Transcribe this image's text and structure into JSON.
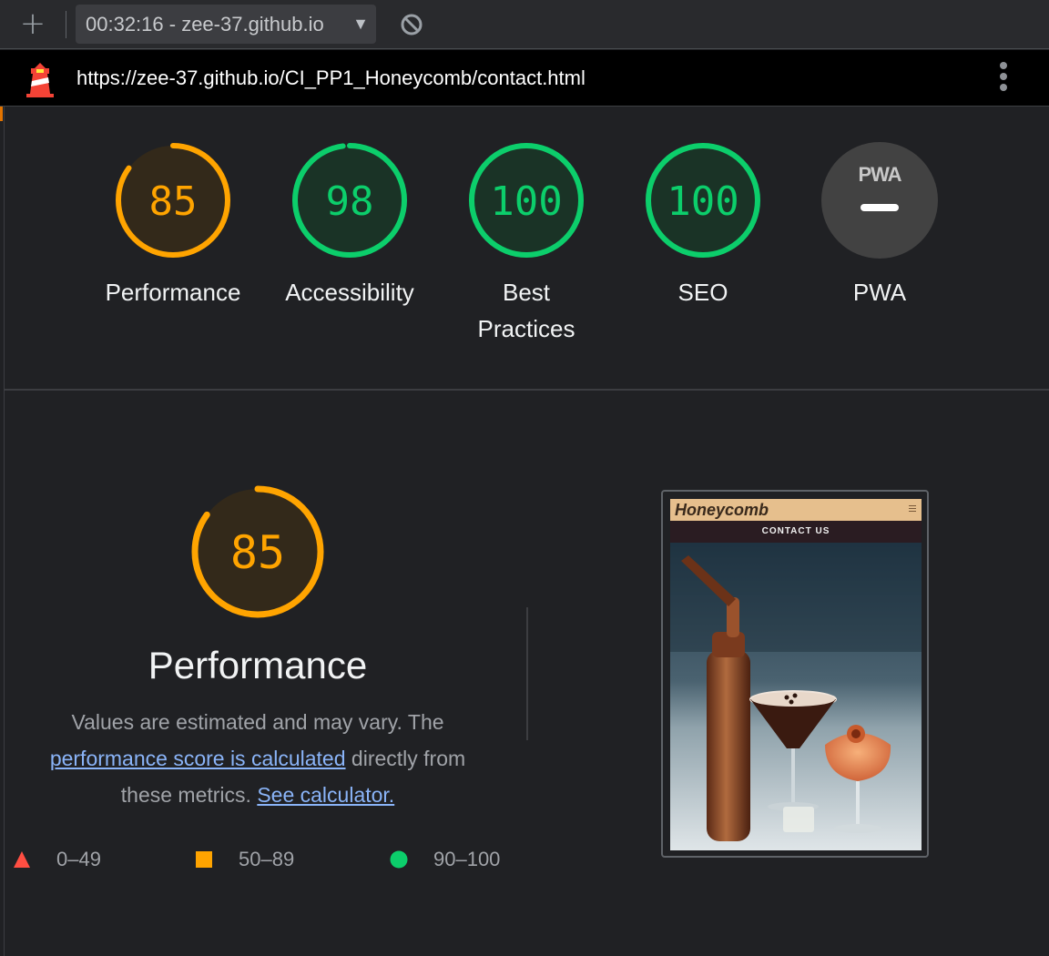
{
  "toolbar": {
    "new_report_icon": "plus-icon",
    "report_selector": "00:32:16 - zee-37.github.io",
    "clear_icon": "block-icon"
  },
  "urlbar": {
    "url": "https://zee-37.github.io/CI_PP1_Honeycomb/contact.html"
  },
  "colors": {
    "average": "#ffa400",
    "pass": "#0cce6b",
    "fail": "#ff4e42",
    "link": "#8ab4f8"
  },
  "gauges": [
    {
      "name": "performance",
      "score": "85",
      "value": 85,
      "label": "Performance",
      "rating": "average"
    },
    {
      "name": "accessibility",
      "score": "98",
      "value": 98,
      "label": "Accessibility",
      "rating": "pass"
    },
    {
      "name": "best-practices",
      "score": "100",
      "value": 100,
      "label": "Best Practices",
      "rating": "pass"
    },
    {
      "name": "seo",
      "score": "100",
      "value": 100,
      "label": "SEO",
      "rating": "pass"
    },
    {
      "name": "pwa",
      "score": "",
      "value": 0,
      "label": "PWA",
      "rating": "na",
      "badge": "PWA"
    }
  ],
  "performance_section": {
    "score": "85",
    "value": 85,
    "title": "Performance",
    "desc_start": "Values are estimated and may vary. The ",
    "link_score": "performance score is calculated",
    "desc_mid": " directly from these metrics. ",
    "link_calc": "See calculator.",
    "legend": [
      {
        "shape": "triangle",
        "range": "0–49"
      },
      {
        "shape": "square",
        "range": "50–89"
      },
      {
        "shape": "circle",
        "range": "90–100"
      }
    ]
  },
  "screenshot": {
    "logo": "Honeycomb",
    "band": "CONTACT US"
  }
}
